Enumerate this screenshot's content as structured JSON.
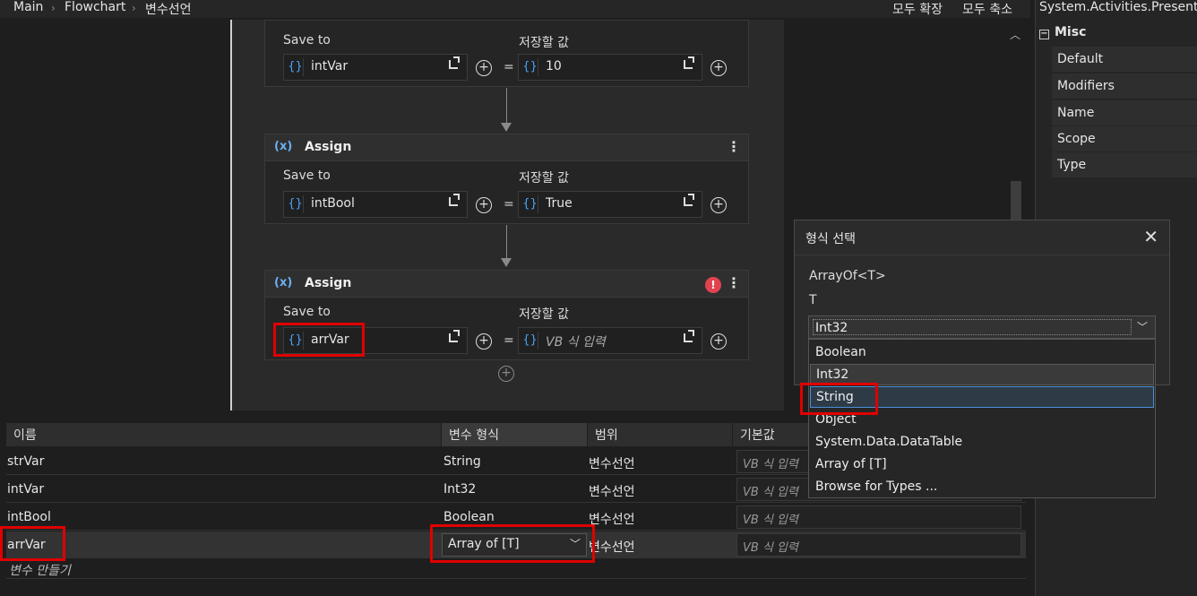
{
  "breadcrumb": {
    "items": [
      "Main",
      "Flowchart",
      "변수선언"
    ]
  },
  "toolbar": {
    "expand_all": "모두 확장",
    "collapse_all": "모두 축소"
  },
  "designer": {
    "cards": [
      {
        "title": "",
        "save_to_label": "Save to",
        "value_label": "저장할 값",
        "save_to": "intVar",
        "value": "10",
        "value_placeholder": false,
        "has_error": false
      },
      {
        "title": "Assign",
        "save_to_label": "Save to",
        "value_label": "저장할 값",
        "save_to": "intBool",
        "value": "True",
        "value_placeholder": false,
        "has_error": false
      },
      {
        "title": "Assign",
        "save_to_label": "Save to",
        "value_label": "저장할 값",
        "save_to": "arrVar",
        "value": "VB 식 입력",
        "value_placeholder": true,
        "has_error": true
      }
    ],
    "brace_symbol": "{}",
    "equals": "="
  },
  "variables": {
    "headers": {
      "name": "이름",
      "type": "변수 형식",
      "scope": "범위",
      "default": "기본값"
    },
    "rows": [
      {
        "name": "strVar",
        "type": "String",
        "scope": "변수선언",
        "default_placeholder": "VB 식 입력"
      },
      {
        "name": "intVar",
        "type": "Int32",
        "scope": "변수선언",
        "default_placeholder": "VB 식 입력"
      },
      {
        "name": "intBool",
        "type": "Boolean",
        "scope": "변수선언",
        "default_placeholder": "VB 식 입력"
      },
      {
        "name": "arrVar",
        "type": "Array of [T]",
        "scope": "변수선언",
        "default_placeholder": "VB 식 입력"
      }
    ],
    "create_label": "변수 만들기"
  },
  "properties": {
    "title": "System.Activities.Presentation",
    "category": "Misc",
    "rows": [
      "Default",
      "Modifiers",
      "Name",
      "Scope",
      "Type"
    ]
  },
  "type_dialog": {
    "title": "형식 선택",
    "type_name": "ArrayOf<T>",
    "param_label": "T",
    "selected": "Int32",
    "options": [
      "Boolean",
      "Int32",
      "String",
      "Object",
      "System.Data.DataTable",
      "Array of [T]",
      "Browse for Types ..."
    ]
  },
  "colors": {
    "accent_blue": "#4aa3ff",
    "error_red": "#e0434f",
    "annotation_red": "#e00000"
  },
  "icons": {
    "assign": "assign-x-icon",
    "expand": "expand-icon",
    "add": "plus-circle-icon",
    "menu": "kebab-menu-icon",
    "close": "close-icon",
    "dropdown": "chevron-down-icon",
    "error": "error-icon"
  }
}
